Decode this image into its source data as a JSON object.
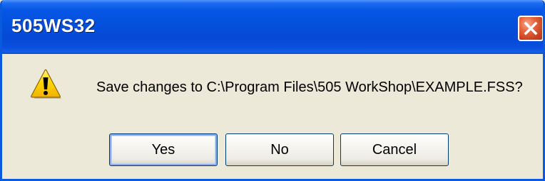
{
  "dialog": {
    "title": "505WS32",
    "message": "Save changes to C:\\Program Files\\505 WorkShop\\EXAMPLE.FSS?",
    "icon": "warning-icon",
    "buttons": {
      "yes": "Yes",
      "no": "No",
      "cancel": "Cancel"
    },
    "colors": {
      "titlebar": "#0450dc",
      "close": "#e5673f",
      "body": "#ece9d8",
      "warning": "#ffd200"
    }
  }
}
